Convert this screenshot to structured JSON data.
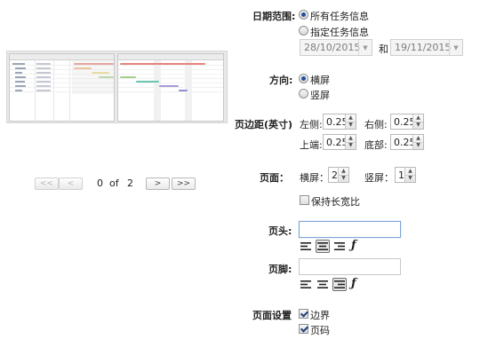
{
  "preview": {
    "pager": {
      "first_label": "<<",
      "prev_label": "<",
      "current": "0",
      "of_label": "of",
      "total": "2",
      "next_label": ">",
      "last_label": ">>"
    }
  },
  "date_range": {
    "label": "日期范围:",
    "option_all": "所有任务信息",
    "option_specified": "指定任务信息",
    "selected": "all",
    "start_date": "28/10/2015",
    "and_label": "和",
    "end_date": "19/11/2015"
  },
  "orientation": {
    "label": "方向:",
    "landscape": "横屏",
    "portrait": "竖屏",
    "selected": "landscape"
  },
  "margins": {
    "label": "页边距(英寸)",
    "left_label": "左侧:",
    "left_value": "0.25",
    "right_label": "右侧:",
    "right_value": "0.25",
    "top_label": "上端:",
    "top_value": "0.25",
    "bottom_label": "底部:",
    "bottom_value": "0.25"
  },
  "pages": {
    "label": "页面：",
    "horizontal_label": "横屏：",
    "horizontal_value": "2",
    "vertical_label": "竖屏：",
    "vertical_value": "1",
    "keep_aspect_label": "保持长宽比",
    "keep_aspect_checked": false
  },
  "header": {
    "label": "页头:",
    "value": "",
    "align_selected": "center"
  },
  "footer": {
    "label": "页脚:",
    "value": "",
    "align_selected": "right"
  },
  "page_setup": {
    "label": "页面设置",
    "border_label": "边界",
    "border_checked": true,
    "page_number_label": "页码",
    "page_number_checked": true
  },
  "icons": {
    "align_left": "align-left-icon",
    "align_center": "align-center-icon",
    "align_right": "align-right-icon",
    "insert_field": "function-icon",
    "spin_up": "arrow-up-icon",
    "spin_down": "arrow-down-icon",
    "dropdown": "chevron-down-icon"
  }
}
